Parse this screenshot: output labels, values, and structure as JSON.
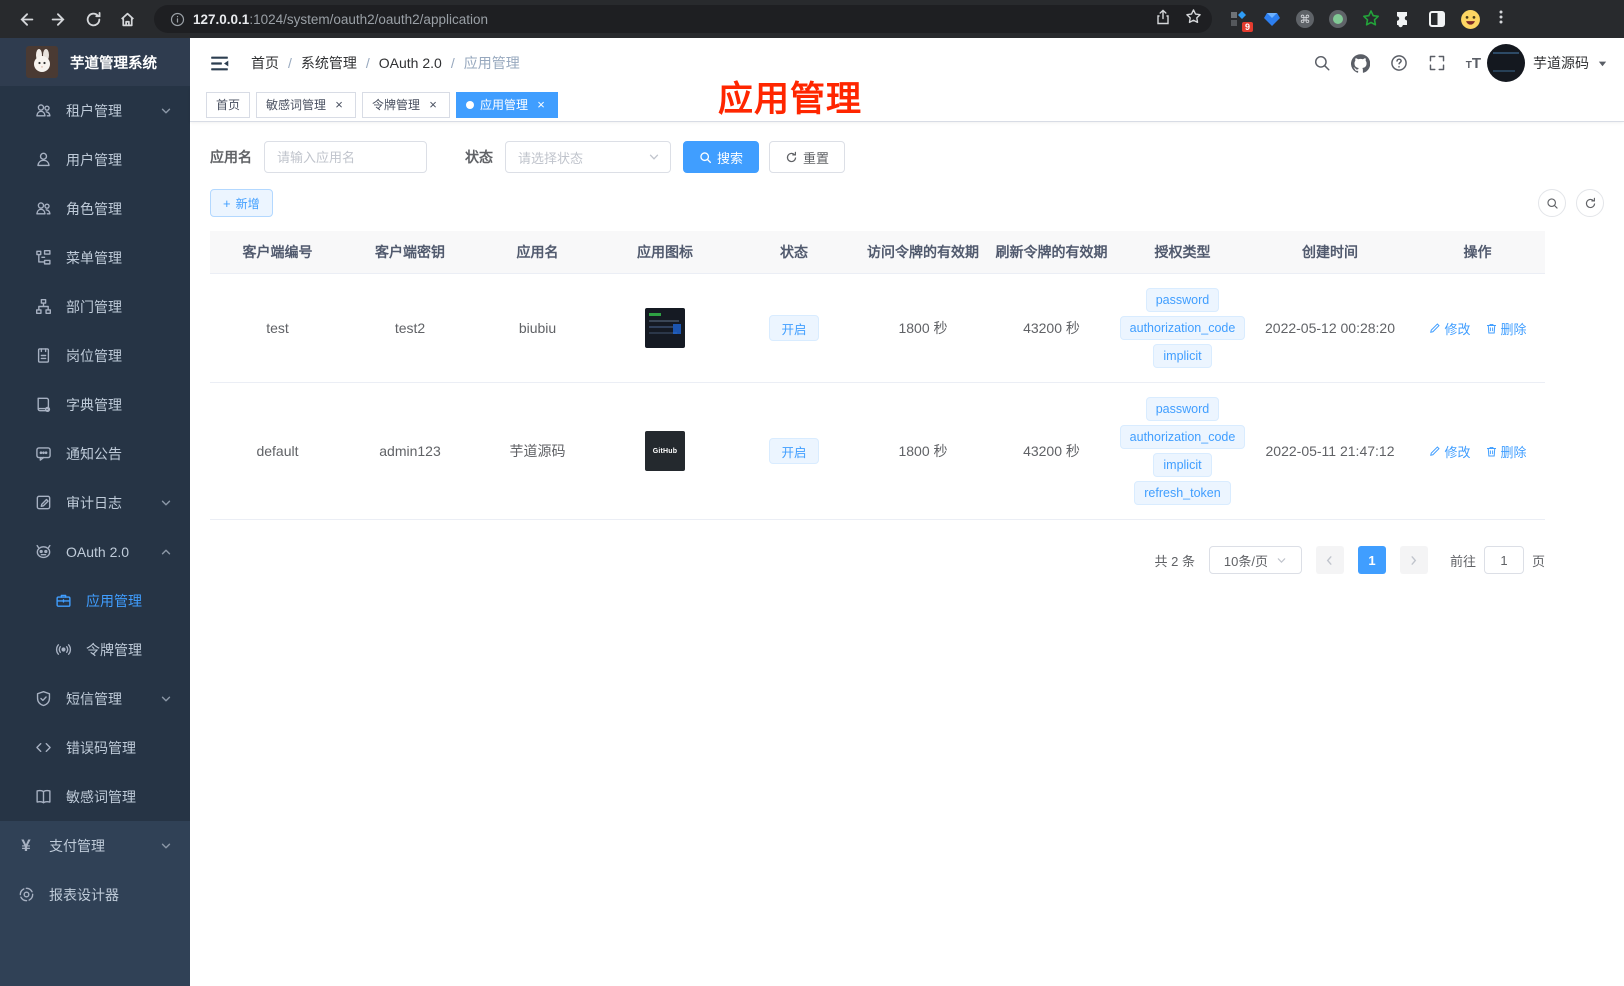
{
  "browser": {
    "url_host": "127.0.0.1",
    "url_rest": ":1024/system/oauth2/oauth2/application",
    "ext_badge": "9",
    "nav_icons": [
      "back-icon",
      "forward-icon",
      "reload-icon",
      "home-icon"
    ],
    "omnibox_icons": [
      "site-info-icon",
      "share-icon",
      "bookmark-star-icon"
    ],
    "ext_icons": [
      "ext-grid-diamond-icon",
      "ext-gem-icon",
      "ext-command-circle-icon",
      "ext-record-circle-icon",
      "ext-green-star-icon",
      "ext-puzzle-icon",
      "ext-split-square-icon",
      "ext-emoji-icon"
    ]
  },
  "sidebar": {
    "title": "芋道管理系统",
    "items": [
      {
        "label": "租户管理",
        "icon": "tenant-users-icon",
        "level": 1,
        "chevron": "down",
        "section": "dark"
      },
      {
        "label": "用户管理",
        "icon": "user-icon",
        "level": 1,
        "section": "dark"
      },
      {
        "label": "角色管理",
        "icon": "role-icon",
        "level": 1,
        "section": "dark"
      },
      {
        "label": "菜单管理",
        "icon": "menu-tree-icon",
        "level": 1,
        "section": "dark"
      },
      {
        "label": "部门管理",
        "icon": "org-icon",
        "level": 1,
        "section": "dark"
      },
      {
        "label": "岗位管理",
        "icon": "post-icon",
        "level": 1,
        "section": "dark"
      },
      {
        "label": "字典管理",
        "icon": "dict-icon",
        "level": 1,
        "section": "dark"
      },
      {
        "label": "通知公告",
        "icon": "notice-icon",
        "level": 1,
        "section": "dark"
      },
      {
        "label": "审计日志",
        "icon": "log-icon",
        "level": 1,
        "chevron": "down",
        "section": "dark"
      },
      {
        "label": "OAuth 2.0",
        "icon": "oauth-icon",
        "level": 1,
        "chevron": "up",
        "section": "dark"
      },
      {
        "label": "应用管理",
        "icon": "app-briefcase-icon",
        "level": 2,
        "active": true,
        "section": "dark"
      },
      {
        "label": "令牌管理",
        "icon": "token-signal-icon",
        "level": 2,
        "section": "dark"
      },
      {
        "label": "短信管理",
        "icon": "sms-shield-icon",
        "level": 1,
        "chevron": "down",
        "section": "dark"
      },
      {
        "label": "错误码管理",
        "icon": "errcode-icon",
        "level": 1,
        "section": "dark"
      },
      {
        "label": "敏感词管理",
        "icon": "sensitive-book-icon",
        "level": 1,
        "section": "dark"
      },
      {
        "label": "支付管理",
        "icon": "pay-yen-icon",
        "level": 0,
        "chevron": "down",
        "section": "base"
      },
      {
        "label": "报表设计器",
        "icon": "report-icon",
        "level": 0,
        "section": "base"
      }
    ]
  },
  "header": {
    "breadcrumb": [
      "首页",
      "系统管理",
      "OAuth 2.0",
      "应用管理"
    ],
    "tools": [
      "search-icon",
      "github-icon",
      "help-icon",
      "fullscreen-icon",
      "fontsize-icon"
    ],
    "user_name": "芋道源码"
  },
  "tabs": [
    {
      "label": "首页",
      "closable": false,
      "active": false
    },
    {
      "label": "敏感词管理",
      "closable": true,
      "active": false
    },
    {
      "label": "令牌管理",
      "closable": true,
      "active": false
    },
    {
      "label": "应用管理",
      "closable": true,
      "active": true
    }
  ],
  "annotation": "应用管理",
  "filters": {
    "name_label": "应用名",
    "name_placeholder": "请输入应用名",
    "status_label": "状态",
    "status_placeholder": "请选择状态",
    "search_label": "搜索",
    "reset_label": "重置"
  },
  "toolbar": {
    "add_label": "新增"
  },
  "table": {
    "headers": [
      "客户端编号",
      "客户端密钥",
      "应用名",
      "应用图标",
      "状态",
      "访问令牌的有效期",
      "刷新令牌的有效期",
      "授权类型",
      "创建时间",
      "操作"
    ],
    "edit_label": "修改",
    "delete_label": "删除",
    "rows": [
      {
        "client_id": "test",
        "secret": "test2",
        "name": "biubiu",
        "icon_kind": "screenshot",
        "icon_label": "",
        "status": "开启",
        "access_ttl": "1800 秒",
        "refresh_ttl": "43200 秒",
        "grants": [
          "password",
          "authorization_code",
          "implicit"
        ],
        "created": "2022-05-12 00:28:20"
      },
      {
        "client_id": "default",
        "secret": "admin123",
        "name": "芋道源码",
        "icon_kind": "github",
        "icon_label": "GitHub",
        "status": "开启",
        "access_ttl": "1800 秒",
        "refresh_ttl": "43200 秒",
        "grants": [
          "password",
          "authorization_code",
          "implicit",
          "refresh_token"
        ],
        "created": "2022-05-11 21:47:12"
      }
    ]
  },
  "pagination": {
    "total": "共 2 条",
    "page_size": "10条/页",
    "current": "1",
    "goto_label": "前往",
    "goto_value": "1",
    "page_label": "页"
  },
  "colors": {
    "accent": "#409eff",
    "annotation": "#ff2600",
    "sidebar_bg": "#304156",
    "submenu_bg": "#263445"
  }
}
